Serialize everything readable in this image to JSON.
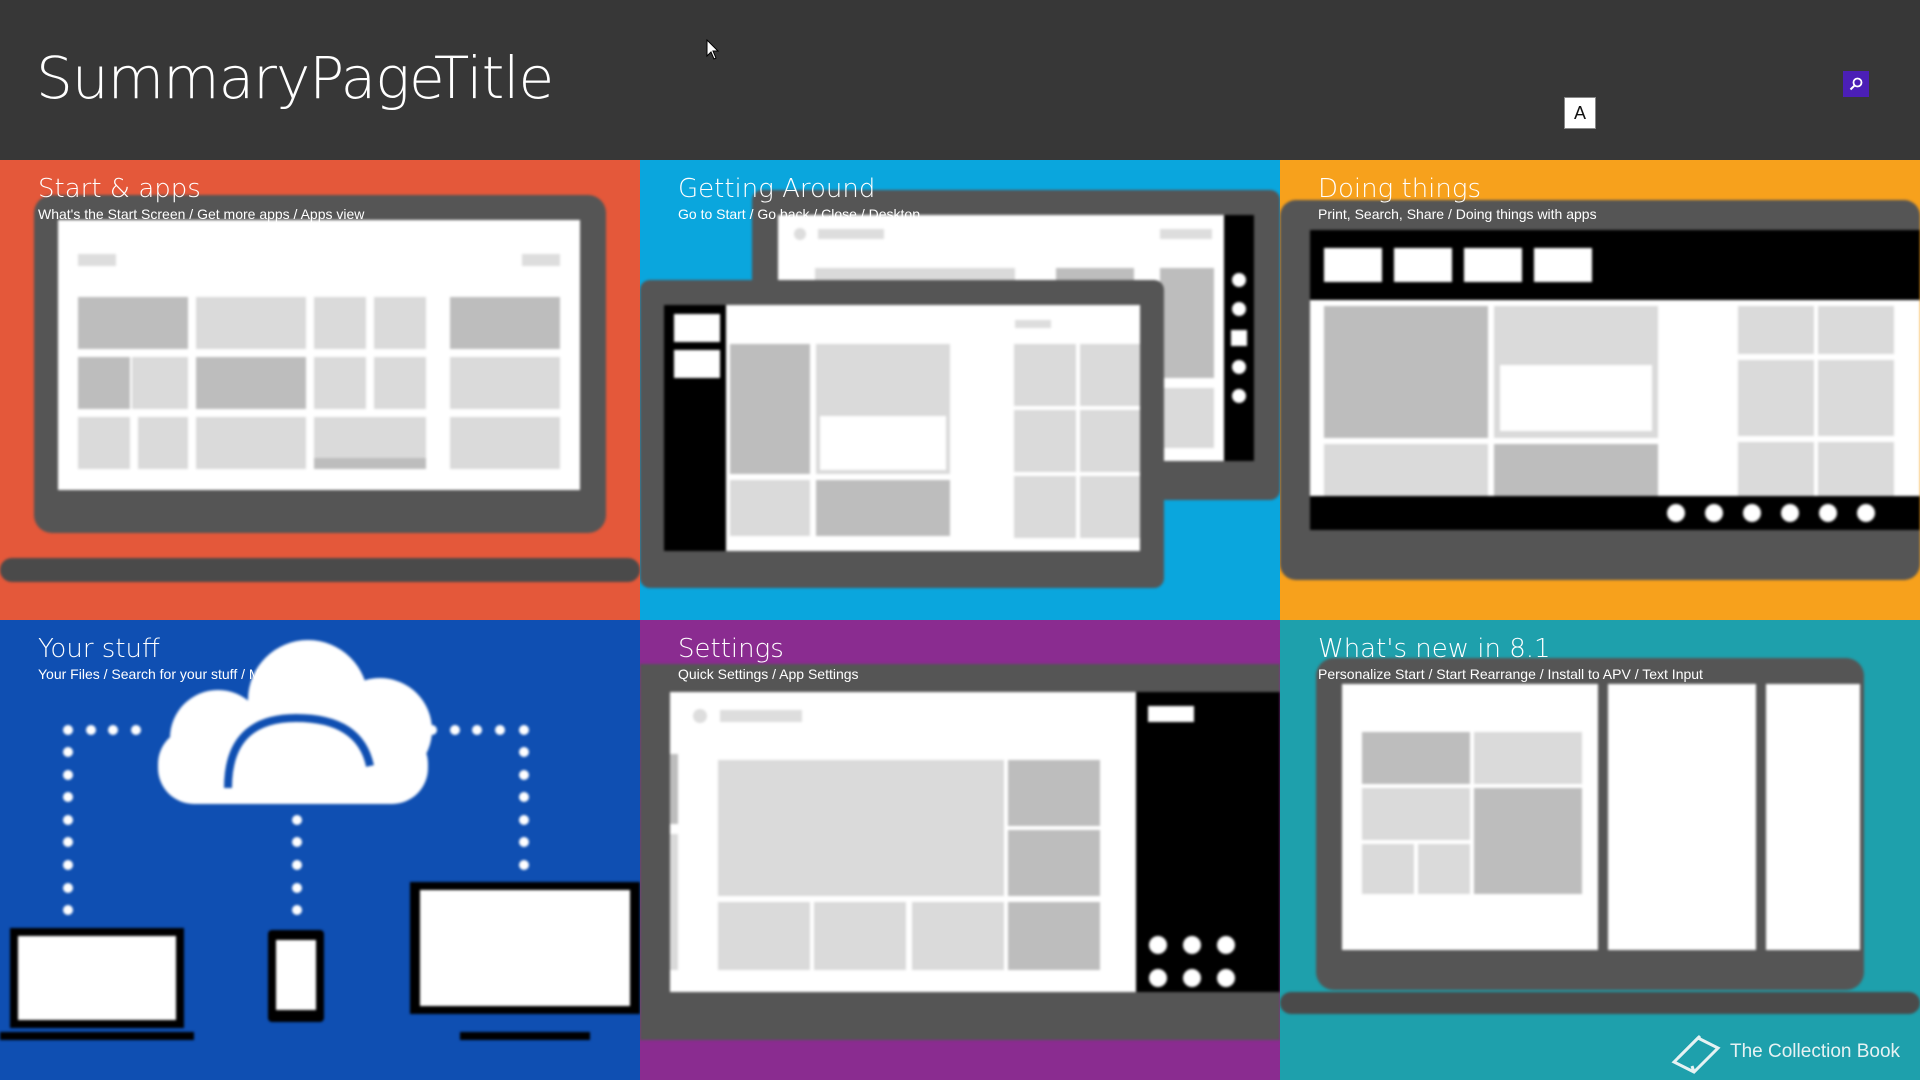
{
  "header": {
    "title": "SummaryPageTitle",
    "key_badge": "A",
    "search_icon": "search-icon"
  },
  "tiles": [
    {
      "title": "Start & apps",
      "subtitle": "What's the Start Screen / Get more apps / Apps view",
      "color": "#e4583a"
    },
    {
      "title": "Getting Around",
      "subtitle": "Go to Start / Go back / Close / Desktop",
      "color": "#0aa6dd"
    },
    {
      "title": "Doing things",
      "subtitle": "Print, Search, Share / Doing things with apps",
      "color": "#f7a11c"
    },
    {
      "title": "Your stuff",
      "subtitle": "Your Files / Search for your stuff / Microsoft account",
      "color": "#0f4fb2"
    },
    {
      "title": "Settings",
      "subtitle": "Quick Settings / App Settings",
      "color": "#8a2c90"
    },
    {
      "title": "What's new in 8.1",
      "subtitle": "Personalize Start / Start Rearrange / Install to APV / Text Input",
      "color": "#1ea0ac"
    }
  ],
  "brand": {
    "name": "The Collection Book",
    "icon": "book-icon"
  }
}
